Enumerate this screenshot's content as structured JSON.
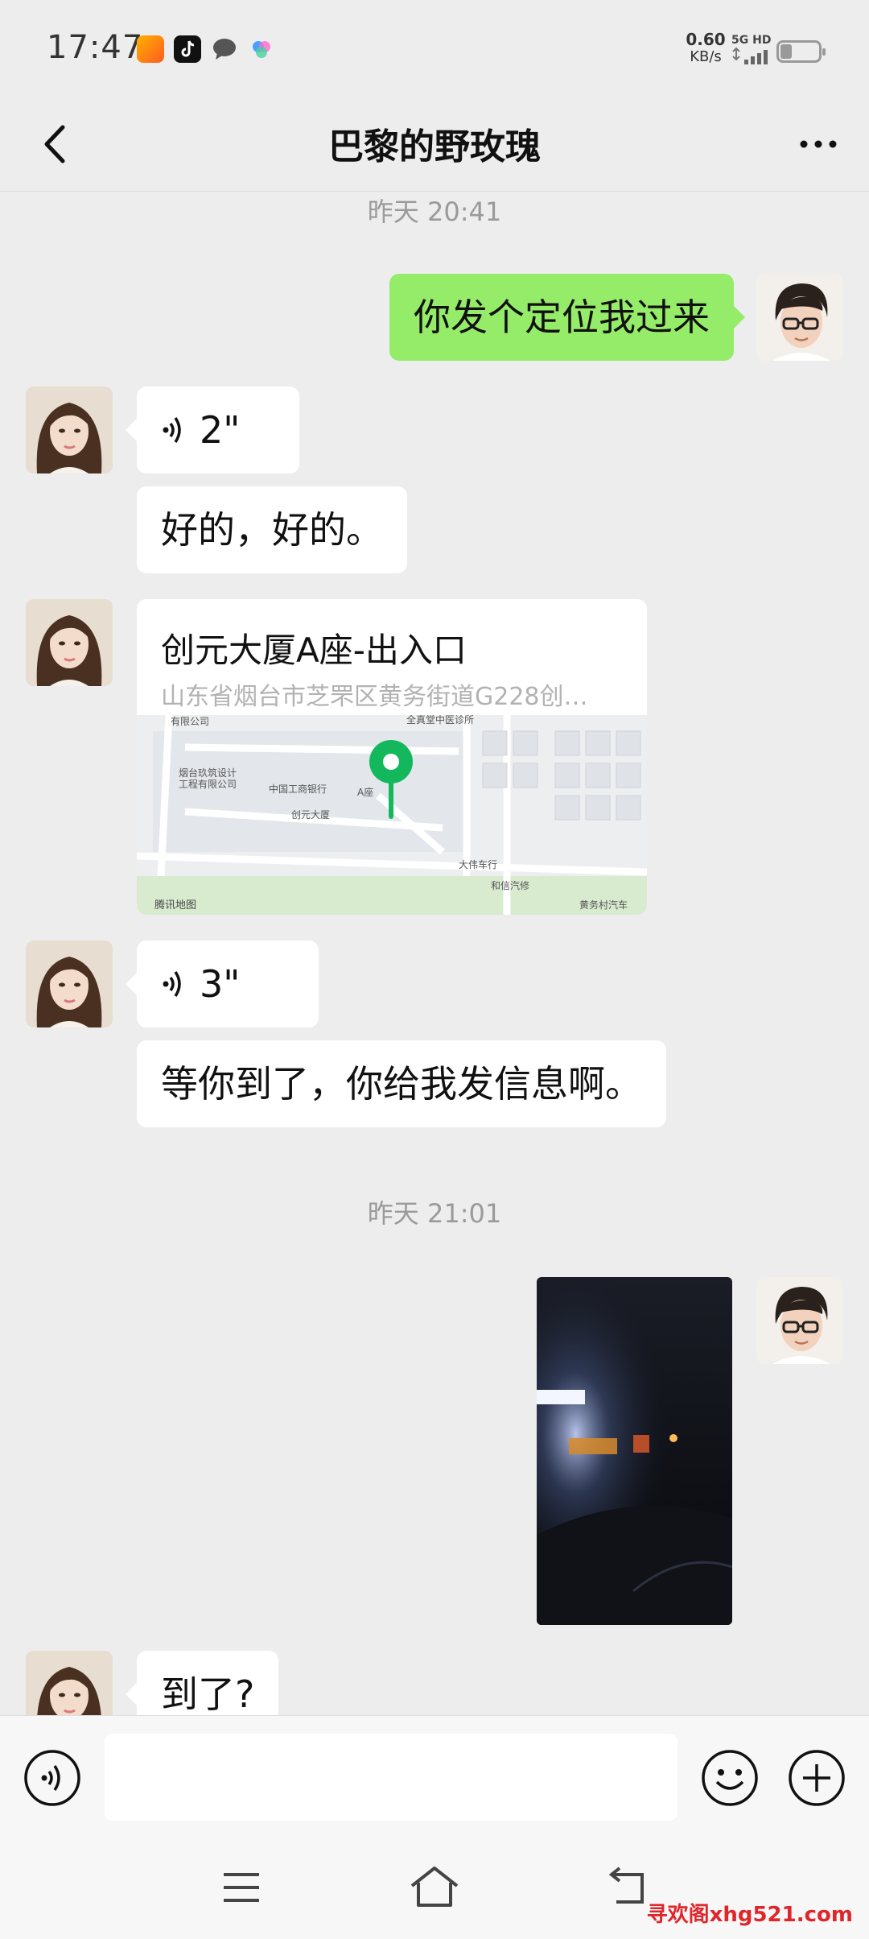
{
  "status_bar": {
    "time": "17:47",
    "net_speed_value": "0.60",
    "net_speed_unit": "KB/s",
    "network": "5G HD"
  },
  "header": {
    "title": "巴黎的野玫瑰"
  },
  "messages": {
    "ts1": "昨天 20:41",
    "out1": "你发个定位我过来",
    "in_voice1": "2\"",
    "in_text1": "好的，好的。",
    "location_name": "创元大厦A座-出入口",
    "location_address": "山东省烟台市芝罘区黄务街道G228创…",
    "map_labels": {
      "company": "有限公司",
      "clinic": "全真堂中医诊所",
      "design": "烟台玖筑设计\n工程有限公司",
      "bank": "中国工商银行",
      "tower": "创元大厦",
      "seat_a": "A座",
      "bike": "大伟车行",
      "hexin": "和信汽修",
      "huangwu": "黄务村汽车",
      "provider": "腾讯地图"
    },
    "in_voice2": "3\"",
    "in_text2": "等你到了，你给我发信息啊。",
    "ts2": "昨天 21:01",
    "in_text3": "到了?"
  },
  "watermark": "寻欢阁xhg521.com",
  "colors": {
    "background": "#ededed",
    "out_bubble": "#95ec69",
    "in_bubble": "#ffffff",
    "map_pin": "#14b85c"
  }
}
